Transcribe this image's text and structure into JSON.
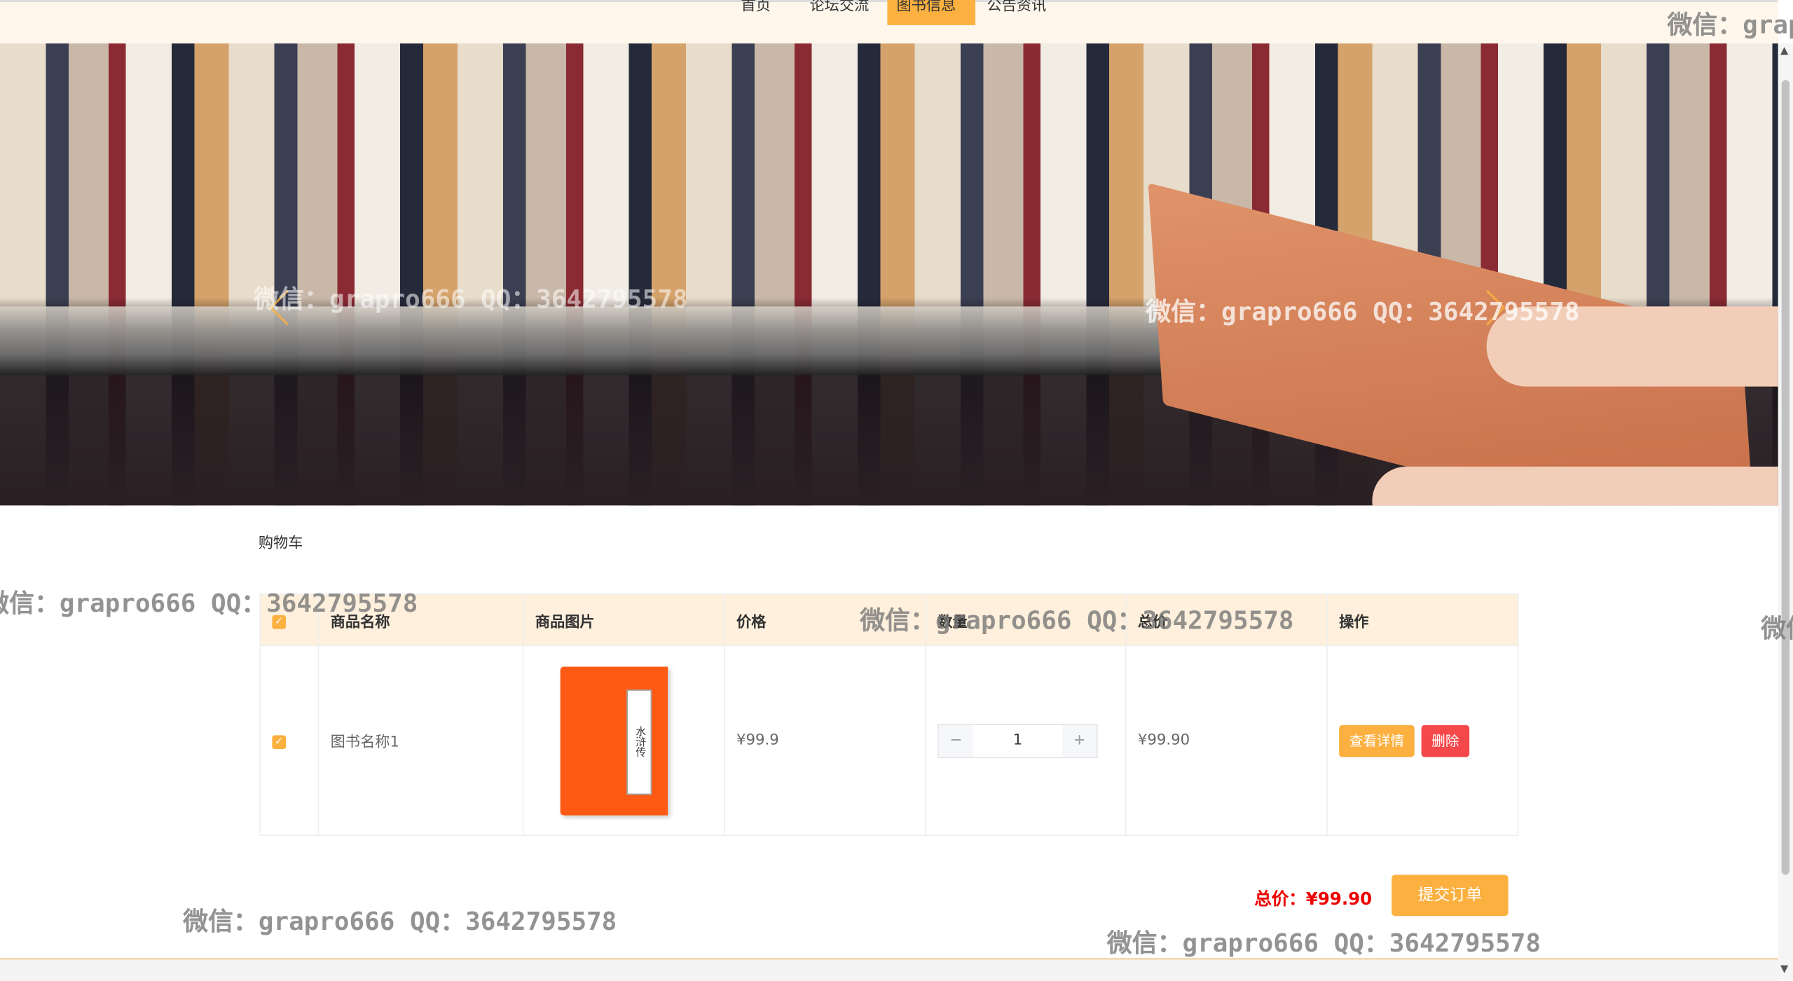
{
  "nav": {
    "items": [
      {
        "label": "首页"
      },
      {
        "label": "论坛交流"
      },
      {
        "label": "图书信息",
        "active": true
      },
      {
        "label": "公告资讯"
      }
    ]
  },
  "cart": {
    "title": "购物车",
    "columns": [
      "商品名称",
      "商品图片",
      "价格",
      "数量",
      "总价",
      "操作"
    ],
    "rows": [
      {
        "checked": true,
        "name": "图书名称1",
        "image_title": "水浒传",
        "price": "¥99.9",
        "quantity": "1",
        "total": "¥99.90",
        "detail_label": "查看详情",
        "delete_label": "删除"
      }
    ],
    "grand_total": "总价：¥99.90",
    "submit_label": "提交订单"
  },
  "icons": {
    "check": "✓",
    "minus": "−",
    "plus": "+",
    "scroll_up": "▲",
    "scroll_down": "▼"
  },
  "watermark": "微信：grapro666 QQ：3642795578",
  "colors": {
    "accent": "#fbb040",
    "danger": "#f5484b",
    "total": "#e00000",
    "nav_bg": "#fff7ec",
    "header_bg": "#fef0dd"
  }
}
